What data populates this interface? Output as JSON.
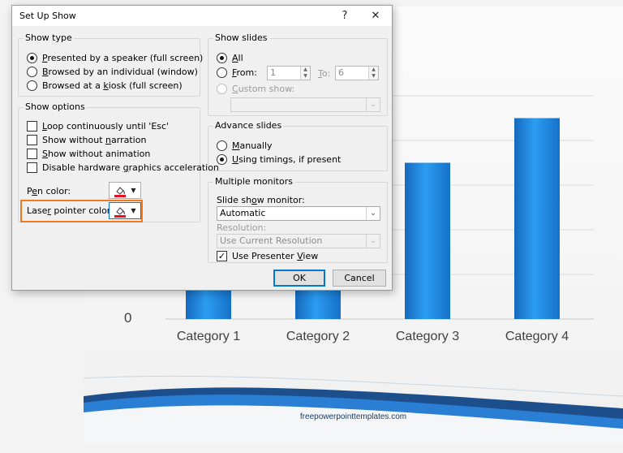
{
  "dialog": {
    "title": "Set Up Show",
    "help_label": "?",
    "close_label": "✕"
  },
  "show_type": {
    "title": "Show type",
    "options": [
      {
        "label": "Presented by a speaker (full screen)",
        "checked": true
      },
      {
        "label": "Browsed by an individual (window)",
        "checked": false
      },
      {
        "label": "Browsed at a kiosk (full screen)",
        "checked": false
      }
    ]
  },
  "show_options": {
    "title": "Show options",
    "checkboxes": [
      {
        "label": "Loop continuously until 'Esc'",
        "checked": false
      },
      {
        "label": "Show without narration",
        "checked": false
      },
      {
        "label": "Show without animation",
        "checked": false
      },
      {
        "label": "Disable hardware graphics acceleration",
        "checked": false
      }
    ],
    "pen_color_label": "Pen color:",
    "laser_color_label": "Laser pointer color:",
    "pen_color": "#e81123",
    "laser_color": "#e81123"
  },
  "show_slides": {
    "title": "Show slides",
    "all_label": "All",
    "from_label": "From:",
    "from_value": "1",
    "to_label": "To:",
    "to_value": "6",
    "custom_label": "Custom show:",
    "custom_value": ""
  },
  "advance_slides": {
    "title": "Advance slides",
    "manually_label": "Manually",
    "timings_label": "Using timings, if present"
  },
  "monitors": {
    "title": "Multiple monitors",
    "monitor_label": "Slide show monitor:",
    "monitor_value": "Automatic",
    "resolution_label": "Resolution:",
    "resolution_value": "Use Current Resolution",
    "presenter_view_label": "Use Presenter View",
    "presenter_view_checked": true
  },
  "buttons": {
    "ok": "OK",
    "cancel": "Cancel"
  },
  "slide": {
    "y_tick": "0",
    "footer": "freepowerpointtemplates.com",
    "accent": "#1f86e0"
  },
  "chart_data": {
    "type": "bar",
    "categories": [
      "Category 1",
      "Category 2",
      "Category 3",
      "Category 4"
    ],
    "values": [
      4.3,
      2.5,
      3.5,
      4.5
    ],
    "ylim": [
      0,
      5
    ]
  }
}
